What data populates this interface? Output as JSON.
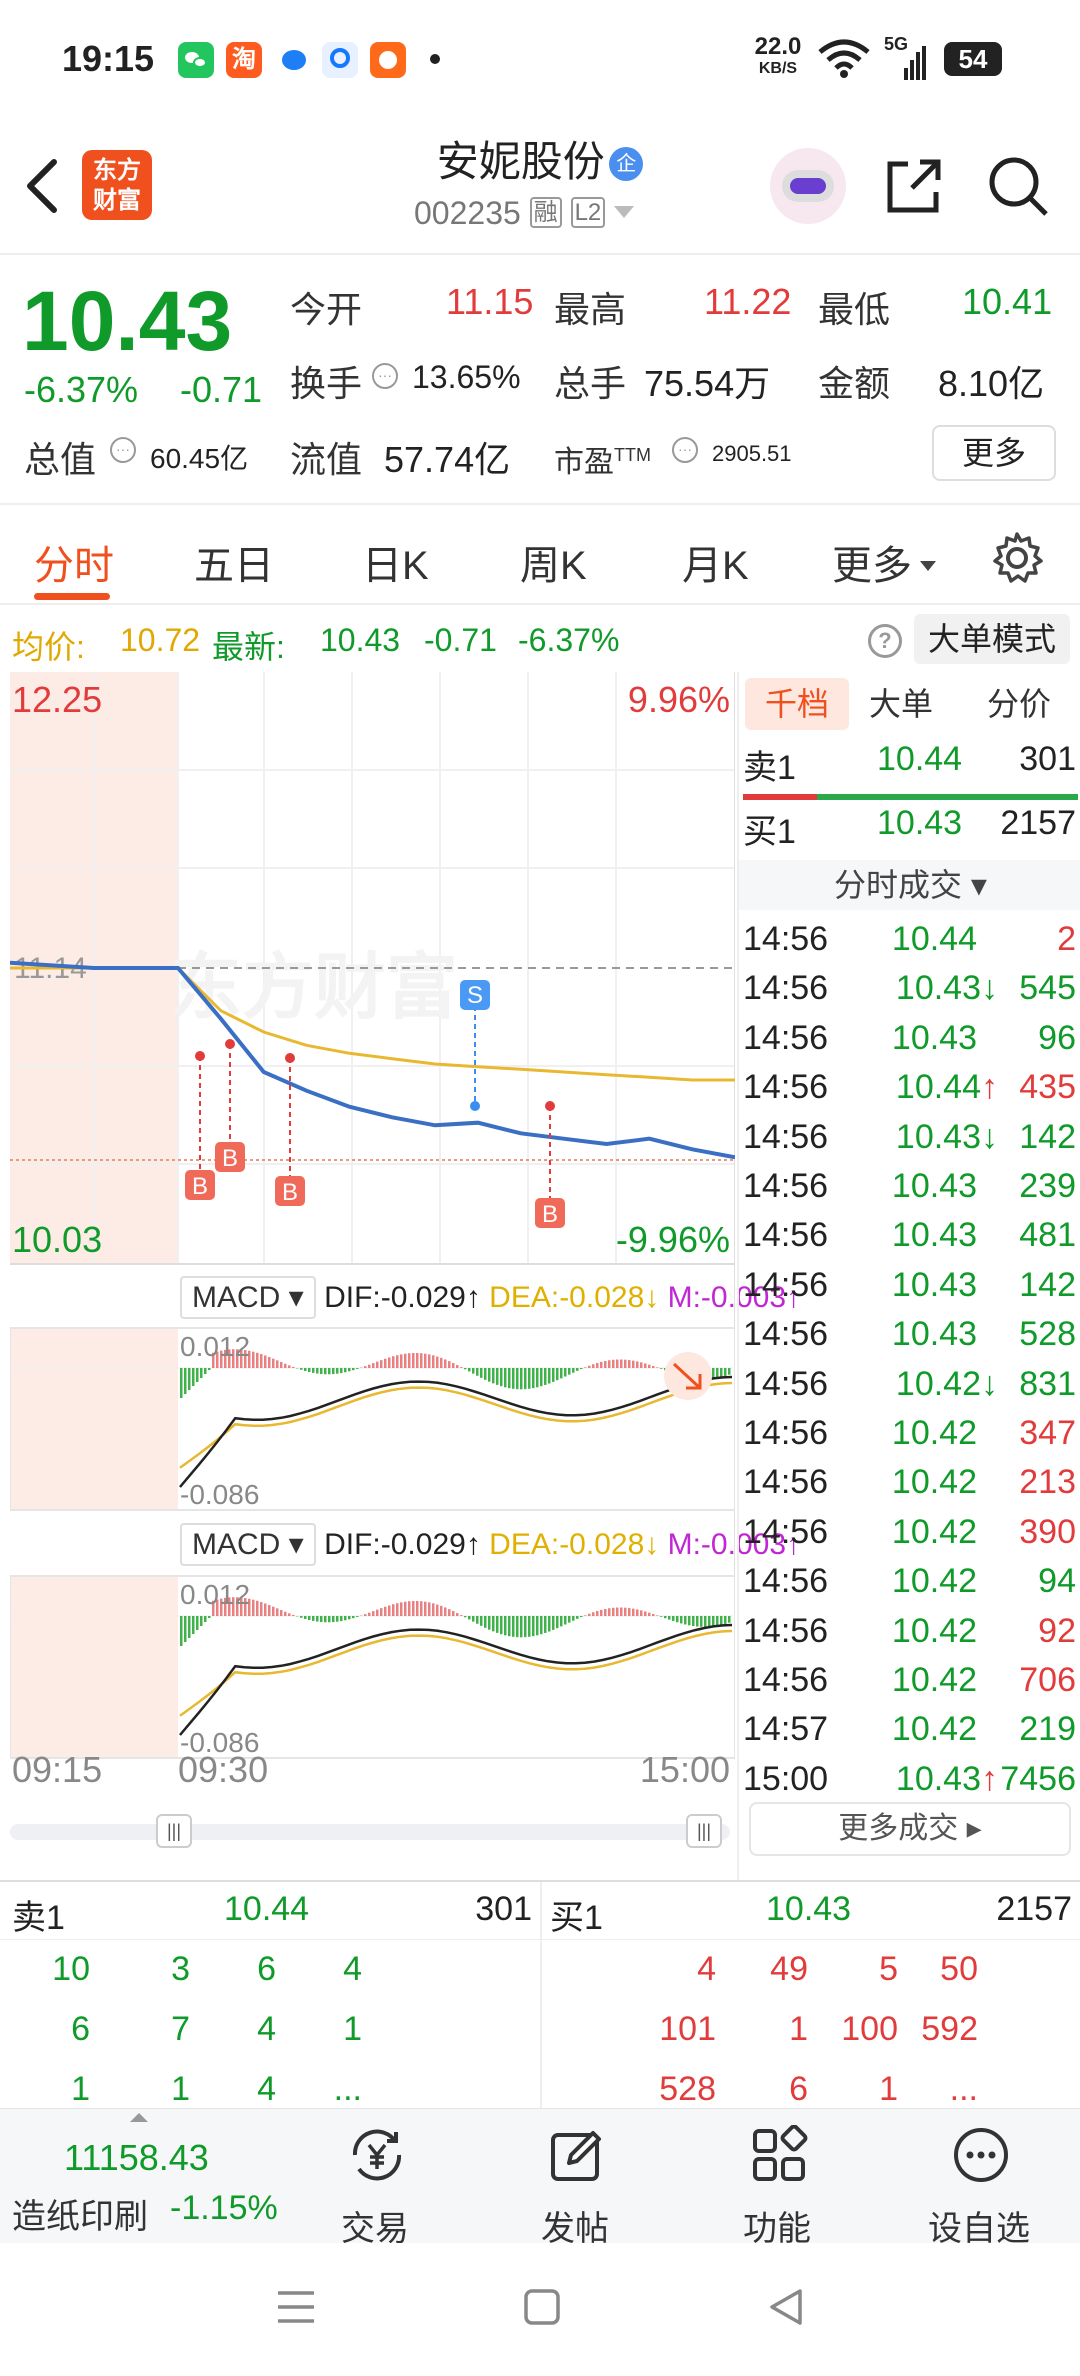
{
  "status_bar": {
    "time": "19:15",
    "net_speed_value": "22.0",
    "net_speed_unit": "KB/S",
    "network": "5G",
    "battery": "54",
    "app_icons": [
      "wechat-icon",
      "taobao-icon",
      "blue-app-icon",
      "alipay-icon",
      "orange-app-icon"
    ]
  },
  "header": {
    "logo_text_line1": "东方",
    "logo_text_line2": "财富",
    "stock_name": "安妮股份",
    "badge": "企",
    "stock_code": "002235",
    "tag_margin": "融",
    "tag_level": "L2"
  },
  "quote": {
    "price": "10.43",
    "change_pct": "-6.37%",
    "change": "-0.71",
    "open_label": "今开",
    "open": "11.15",
    "high_label": "最高",
    "high": "11.22",
    "low_label": "最低",
    "low": "10.41",
    "turnover_label": "换手",
    "turnover": "13.65%",
    "volume_label": "总手",
    "volume": "75.54万",
    "amount_label": "金额",
    "amount": "8.10亿",
    "mktcap_label": "总值",
    "mktcap": "60.45亿",
    "float_label": "流值",
    "float_cap": "57.74亿",
    "pe_label": "市盈",
    "pe_sup": "TTM",
    "pe": "2905.51",
    "more_button": "更多"
  },
  "tabs": [
    {
      "label": "分时",
      "active": true
    },
    {
      "label": "五日"
    },
    {
      "label": "日K"
    },
    {
      "label": "周K"
    },
    {
      "label": "月K"
    },
    {
      "label": "更多"
    }
  ],
  "avg_bar": {
    "avg_label": "均价:",
    "avg_value": "10.72",
    "latest_label": "最新:",
    "latest_value": "10.43",
    "latest_change": "-0.71",
    "latest_pct": "-6.37%",
    "mode_button": "大单模式"
  },
  "chart": {
    "y_top": "12.25",
    "y_bottom": "10.03",
    "pct_top": "9.96%",
    "pct_bottom": "-9.96%",
    "ref_price": "11.14",
    "watermark": "东方财富",
    "marker_b": "B",
    "marker_s": "S",
    "macd_label": "MACD",
    "dif": "DIF:-0.029↑",
    "dea": "DEA:-0.028↓",
    "m": "M:-0.003↑",
    "macd_top": "0.012",
    "macd_bottom": "-0.086",
    "time_start": "09:15",
    "time_open": "09:30",
    "time_end": "15:00",
    "colors": {
      "price": "#3a6fc4",
      "avg": "#e8b830",
      "red": "#e23b3b",
      "green": "#0f9a2a",
      "pre_market_bg": "#fdece6"
    }
  },
  "chart_data": {
    "type": "line",
    "x": [
      "09:15",
      "09:30",
      "15:00"
    ],
    "series": [
      {
        "values": [
          11.16,
          11.14,
          11.14,
          10.95,
          10.75,
          10.68,
          10.62,
          10.58,
          10.55,
          10.56,
          10.52,
          10.5,
          10.48,
          10.5,
          10.46,
          10.43
        ]
      },
      {
        "values": [
          11.14,
          11.14,
          11.14,
          10.98,
          10.9,
          10.85,
          10.82,
          10.8,
          10.78,
          10.77,
          10.76,
          10.75,
          10.74,
          10.73,
          10.72,
          10.72
        ]
      }
    ],
    "ylim": [
      10.03,
      12.25
    ]
  },
  "book_tabs": [
    "千档",
    "大单",
    "分价"
  ],
  "book_top": {
    "sell_label": "卖1",
    "sell_price": "10.44",
    "sell_vol": "301",
    "buy_label": "买1",
    "buy_price": "10.43",
    "buy_vol": "2157"
  },
  "trades_header": "分时成交",
  "trades": [
    {
      "t": "14:56",
      "p": "10.44",
      "v": "2",
      "dir": "",
      "color": "red"
    },
    {
      "t": "14:56",
      "p": "10.43",
      "v": "545",
      "dir": "↓",
      "color": "green"
    },
    {
      "t": "14:56",
      "p": "10.43",
      "v": "96",
      "dir": "",
      "color": "green"
    },
    {
      "t": "14:56",
      "p": "10.44",
      "v": "435",
      "dir": "↑",
      "color": "red"
    },
    {
      "t": "14:56",
      "p": "10.43",
      "v": "142",
      "dir": "↓",
      "color": "green"
    },
    {
      "t": "14:56",
      "p": "10.43",
      "v": "239",
      "dir": "",
      "color": "green"
    },
    {
      "t": "14:56",
      "p": "10.43",
      "v": "481",
      "dir": "",
      "color": "green"
    },
    {
      "t": "14:56",
      "p": "10.43",
      "v": "142",
      "dir": "",
      "color": "green"
    },
    {
      "t": "14:56",
      "p": "10.43",
      "v": "528",
      "dir": "",
      "color": "green"
    },
    {
      "t": "14:56",
      "p": "10.42",
      "v": "831",
      "dir": "↓",
      "color": "green"
    },
    {
      "t": "14:56",
      "p": "10.42",
      "v": "347",
      "dir": "",
      "color": "red"
    },
    {
      "t": "14:56",
      "p": "10.42",
      "v": "213",
      "dir": "",
      "color": "red"
    },
    {
      "t": "14:56",
      "p": "10.42",
      "v": "390",
      "dir": "",
      "color": "red"
    },
    {
      "t": "14:56",
      "p": "10.42",
      "v": "94",
      "dir": "",
      "color": "green"
    },
    {
      "t": "14:56",
      "p": "10.42",
      "v": "92",
      "dir": "",
      "color": "red"
    },
    {
      "t": "14:56",
      "p": "10.42",
      "v": "706",
      "dir": "",
      "color": "red"
    },
    {
      "t": "14:57",
      "p": "10.42",
      "v": "219",
      "dir": "",
      "color": "green"
    },
    {
      "t": "15:00",
      "p": "10.43",
      "v": "7456",
      "dir": "↑",
      "color": "green"
    }
  ],
  "more_trades_button": "更多成交",
  "depth": {
    "sell_label": "卖1",
    "sell_price": "10.44",
    "sell_vol": "301",
    "buy_label": "买1",
    "buy_price": "10.43",
    "buy_vol": "2157",
    "sell_rows": [
      [
        "10",
        "3",
        "6",
        "4"
      ],
      [
        "6",
        "7",
        "4",
        "1"
      ],
      [
        "1",
        "1",
        "4",
        "..."
      ]
    ],
    "buy_rows": [
      [
        "4",
        "49",
        "5",
        "50"
      ],
      [
        "101",
        "1",
        "100",
        "592"
      ],
      [
        "528",
        "6",
        "1",
        "..."
      ]
    ]
  },
  "bottom_nav": {
    "index_value": "11158.43",
    "index_name": "造纸印刷",
    "index_pct": "-1.15%",
    "items": [
      {
        "label": "交易",
        "icon": "yen-exchange-icon"
      },
      {
        "label": "发帖",
        "icon": "edit-post-icon"
      },
      {
        "label": "功能",
        "icon": "grid-apps-icon"
      },
      {
        "label": "设自选",
        "icon": "more-circle-icon"
      }
    ]
  }
}
